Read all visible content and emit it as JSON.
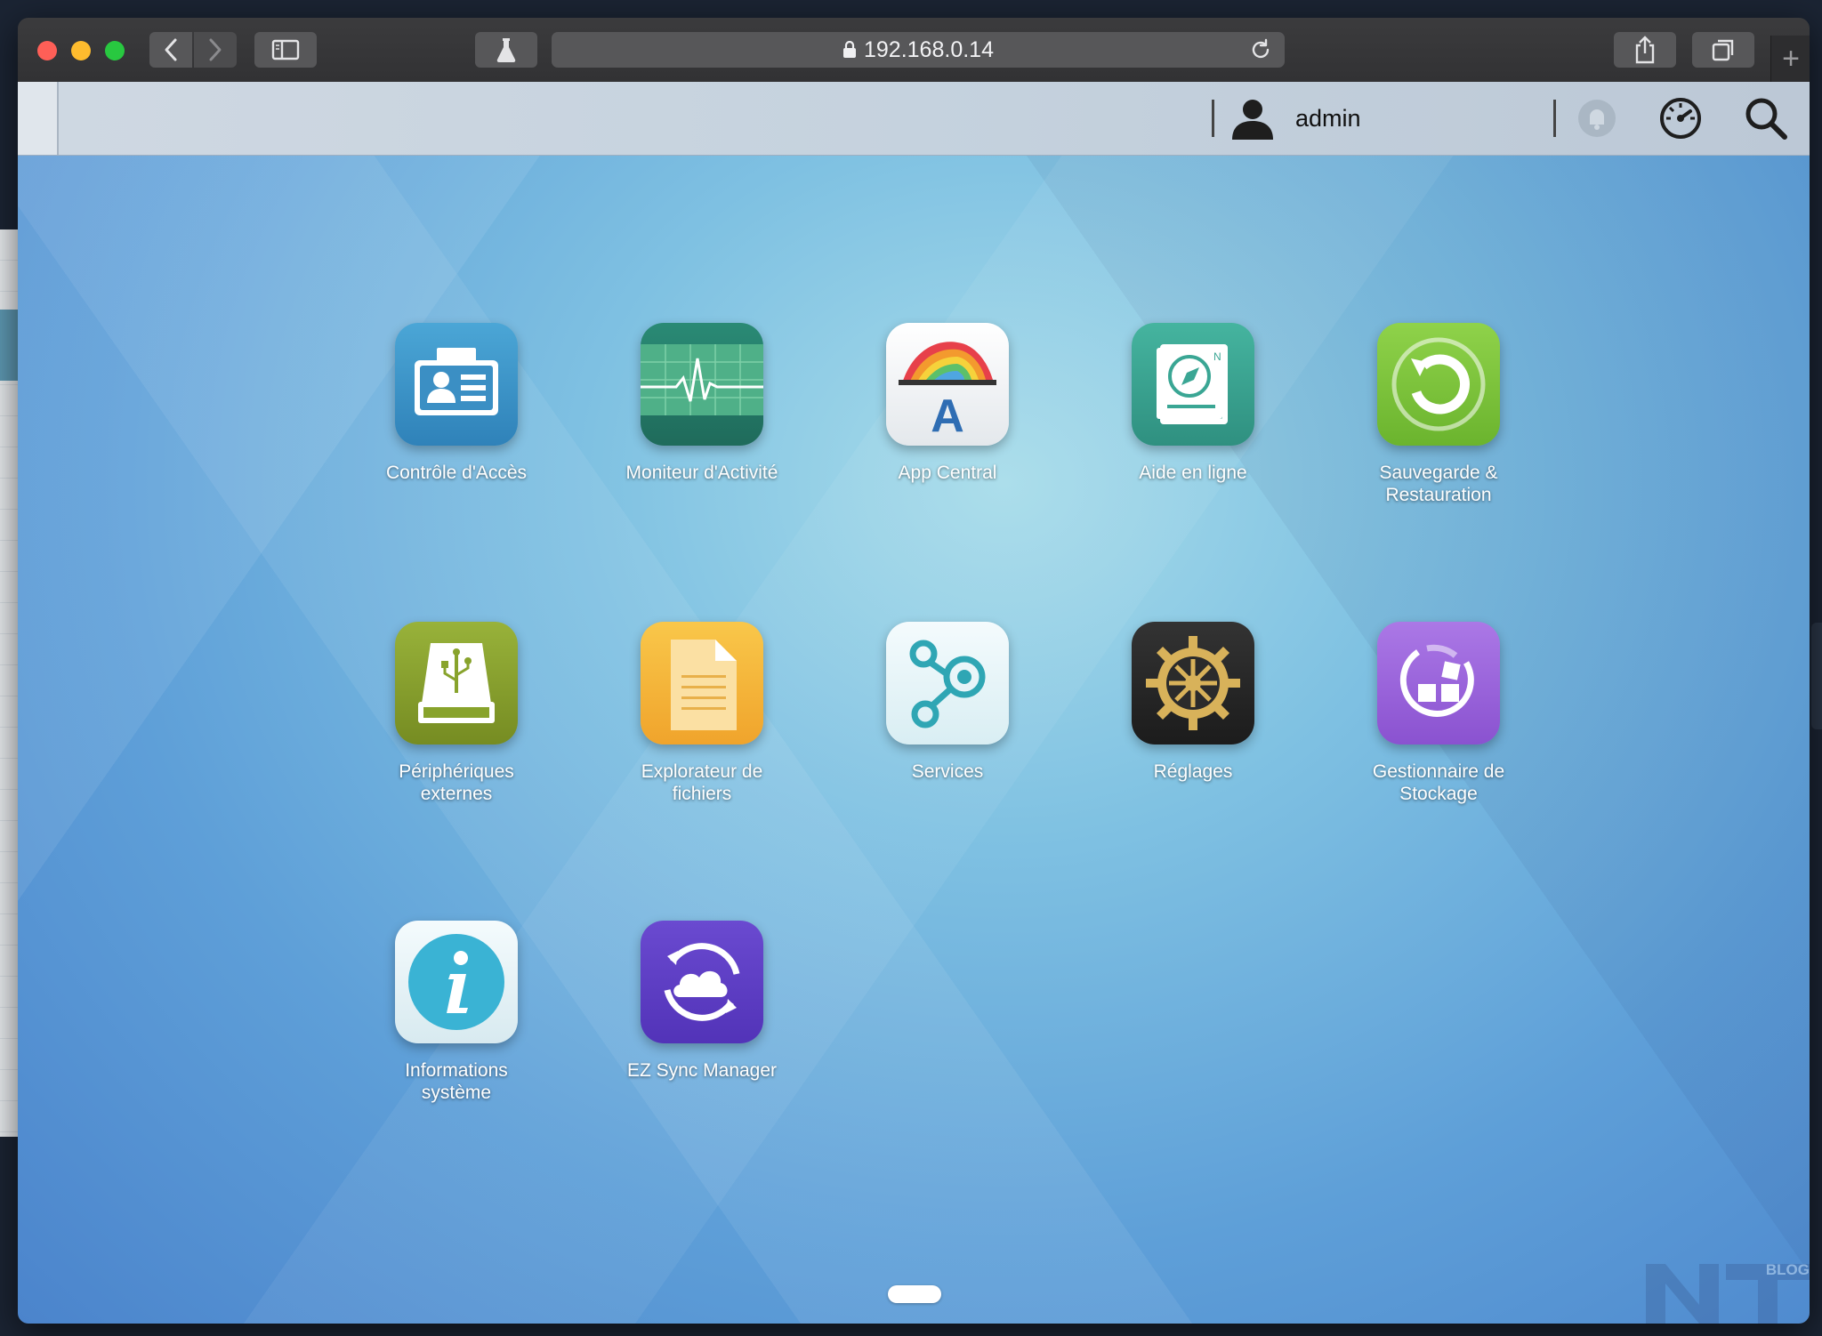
{
  "browser": {
    "url": "192.168.0.14",
    "new_tab_symbol": "+"
  },
  "topbar": {
    "username": "admin"
  },
  "apps": [
    {
      "label": "Contrôle d'Accès",
      "icon": "access-control-icon"
    },
    {
      "label": "Moniteur d'Activité",
      "icon": "activity-monitor-icon"
    },
    {
      "label": "App Central",
      "icon": "app-central-icon"
    },
    {
      "label": "Aide en ligne",
      "icon": "online-help-icon"
    },
    {
      "label": "Sauvegarde &\nRestauration",
      "icon": "backup-restore-icon"
    },
    {
      "label": "Périphériques\nexternes",
      "icon": "external-devices-icon"
    },
    {
      "label": "Explorateur de\nfichiers",
      "icon": "file-explorer-icon"
    },
    {
      "label": "Services",
      "icon": "services-icon"
    },
    {
      "label": "Réglages",
      "icon": "settings-gear-icon"
    },
    {
      "label": "Gestionnaire de\nStockage",
      "icon": "storage-manager-icon"
    },
    {
      "label": "Informations\nsystème",
      "icon": "system-info-icon"
    },
    {
      "label": "EZ Sync Manager",
      "icon": "ez-sync-icon"
    }
  ],
  "watermark": {
    "text": "BLOG"
  },
  "colors": {
    "access": "#3d93c6",
    "activity": "#2f8e7a",
    "help": "#3aa694",
    "backup": "#7cc43b",
    "external": "#88a32c",
    "files": "#f3b43a",
    "settings": "#2b2b2b",
    "storage": "#9a63dc",
    "ezsync": "#5f3fc7"
  }
}
